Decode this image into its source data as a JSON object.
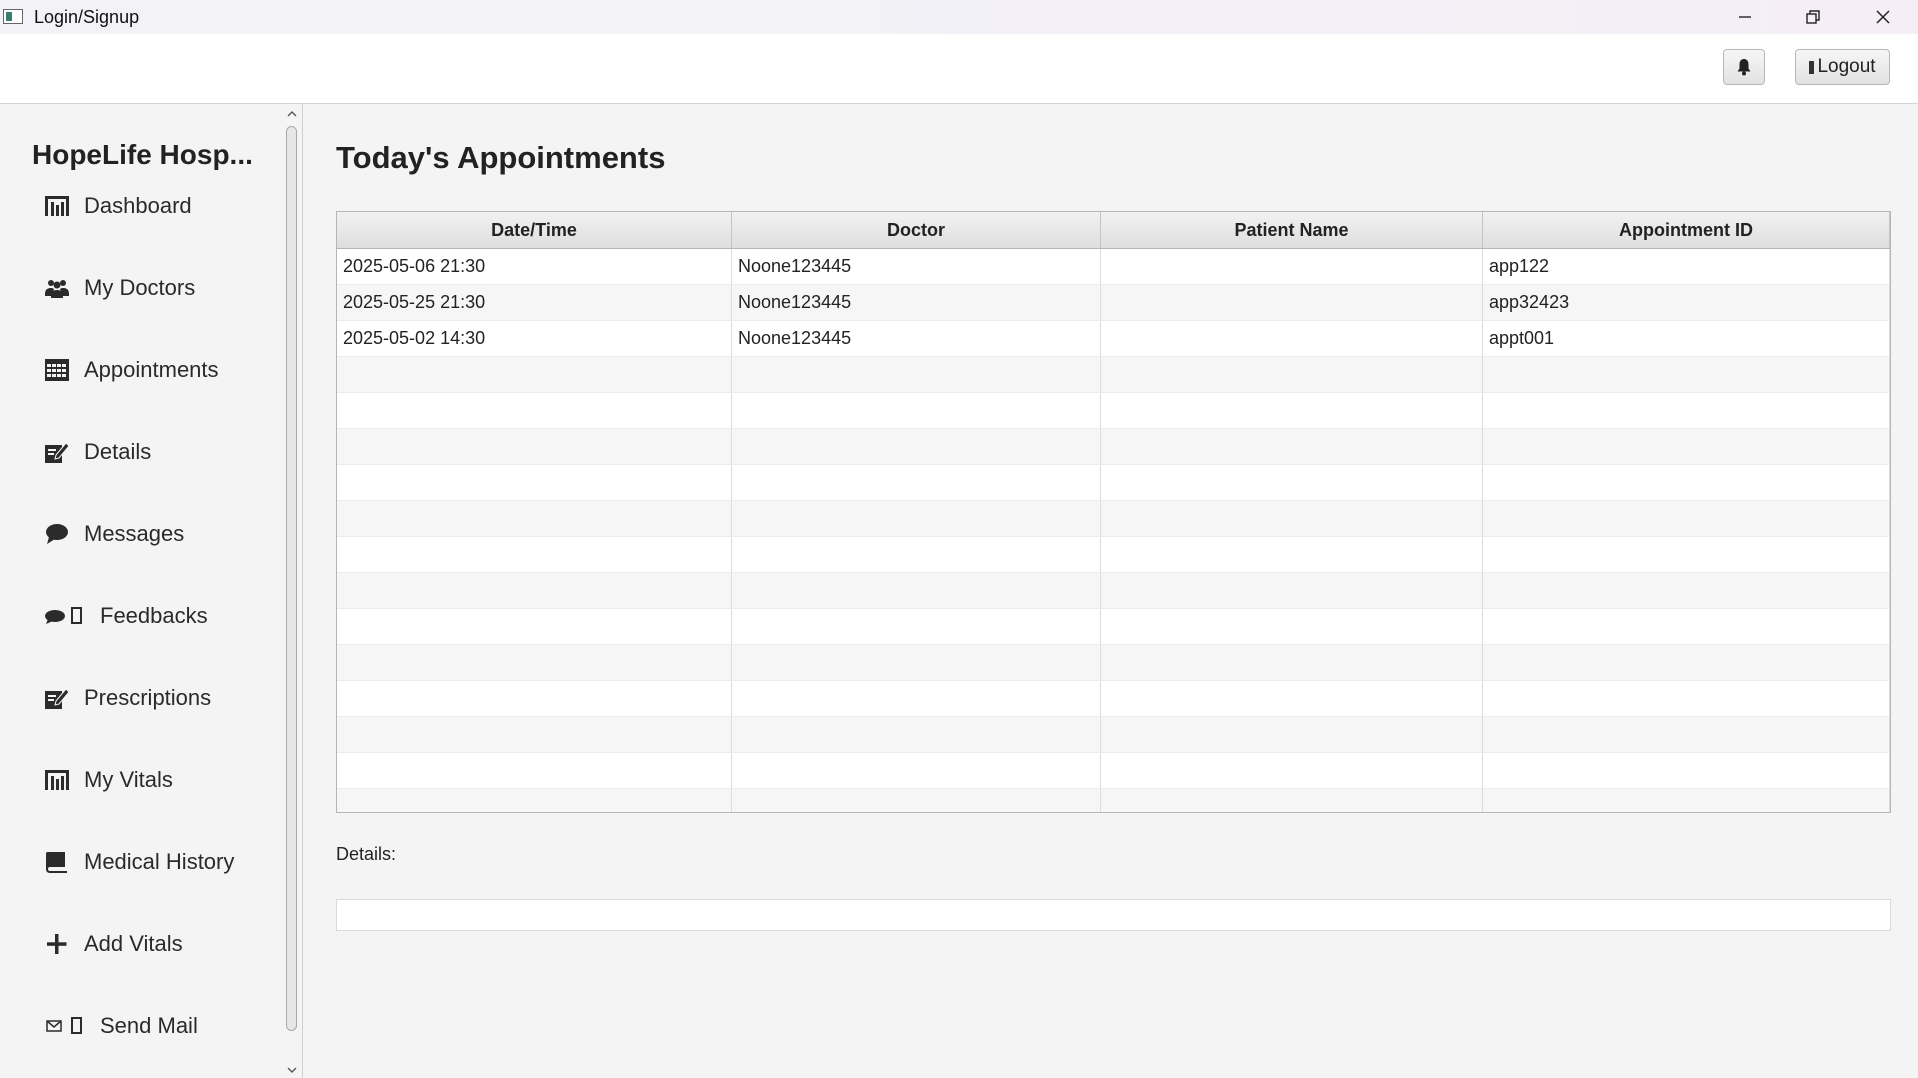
{
  "window": {
    "title": "Login/Signup",
    "controls": [
      "minimize",
      "restore",
      "close"
    ]
  },
  "toolbar": {
    "notifications_icon": "bell-icon",
    "logout_label": "Logout"
  },
  "sidebar": {
    "brand": "HopeLife Hosp...",
    "items": [
      {
        "label": "Dashboard",
        "icon": "bar-chart-icon"
      },
      {
        "label": "My Doctors",
        "icon": "users-icon"
      },
      {
        "label": "Appointments",
        "icon": "calendar-icon"
      },
      {
        "label": "Details",
        "icon": "edit-icon"
      },
      {
        "label": "Messages",
        "icon": "chat-bubble-icon"
      },
      {
        "label": "Feedbacks",
        "icon": "comments-icon"
      },
      {
        "label": "Prescriptions",
        "icon": "edit-icon"
      },
      {
        "label": "My Vitals",
        "icon": "bar-chart-icon"
      },
      {
        "label": "Medical History",
        "icon": "book-icon"
      },
      {
        "label": "Add Vitals",
        "icon": "plus-icon"
      },
      {
        "label": "Send Mail",
        "icon": "envelope-icon"
      }
    ]
  },
  "main": {
    "title": "Today's Appointments",
    "table": {
      "columns": [
        "Date/Time",
        "Doctor",
        "Patient Name",
        "Appointment ID"
      ],
      "rows": [
        [
          "2025-05-06 21:30",
          "Noone123445",
          "",
          "app122"
        ],
        [
          "2025-05-25 21:30",
          "Noone123445",
          "",
          "app32423"
        ],
        [
          "2025-05-02 14:30",
          "Noone123445",
          "",
          "appt001"
        ]
      ]
    },
    "details_label": "Details:",
    "details_value": ""
  }
}
